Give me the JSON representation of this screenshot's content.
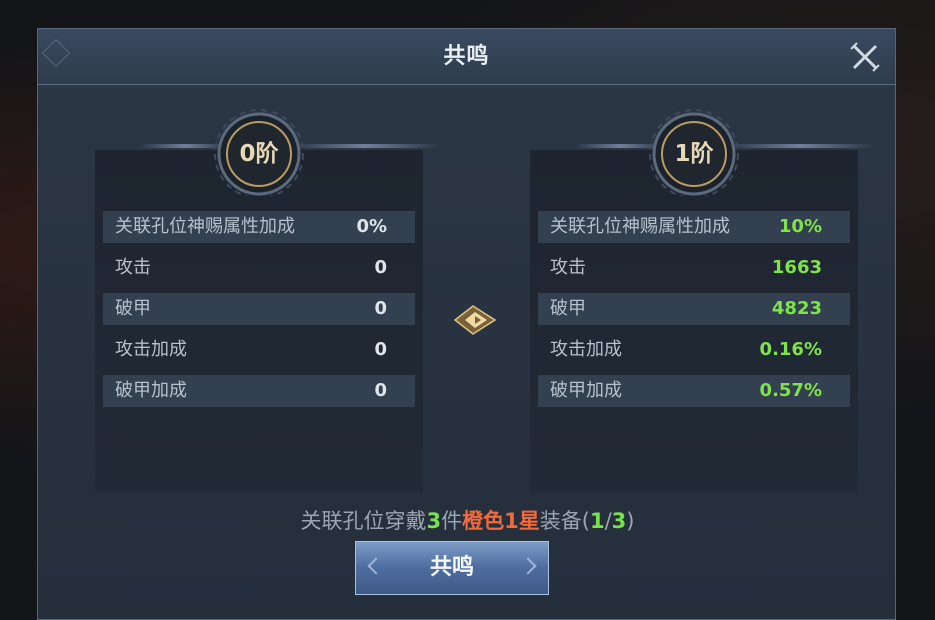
{
  "dialog": {
    "title": "共鸣"
  },
  "left": {
    "tier": "0阶",
    "stats": [
      {
        "name": "关联孔位神赐属性加成",
        "value": "0%"
      },
      {
        "name": "攻击",
        "value": "0"
      },
      {
        "name": "破甲",
        "value": "0"
      },
      {
        "name": "攻击加成",
        "value": "0"
      },
      {
        "name": "破甲加成",
        "value": "0"
      }
    ]
  },
  "right": {
    "tier": "1阶",
    "stats": [
      {
        "name": "关联孔位神赐属性加成",
        "value": "10%"
      },
      {
        "name": "攻击",
        "value": "1663"
      },
      {
        "name": "破甲",
        "value": "4823"
      },
      {
        "name": "攻击加成",
        "value": "0.16%"
      },
      {
        "name": "破甲加成",
        "value": "0.57%"
      }
    ]
  },
  "requirement": {
    "prefix": "关联孔位穿戴",
    "count": "3",
    "unit": "件",
    "quality": "橙色1星",
    "item": "装备",
    "open": "(",
    "current": "1",
    "slash": "/",
    "total": "3",
    "close": ")"
  },
  "button": {
    "label": "共鸣"
  },
  "icons": {
    "close": "close-icon",
    "arrow": "upgrade-arrow-icon",
    "emblem": "tier-emblem-icon"
  },
  "colors": {
    "green": "#7fe34a",
    "orange": "#f26a3b",
    "button": "#4f6d9f"
  }
}
